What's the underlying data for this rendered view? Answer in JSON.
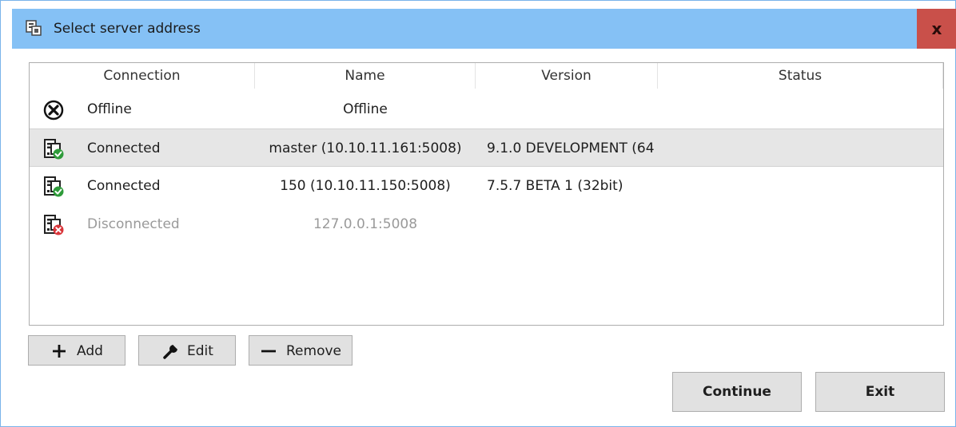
{
  "window": {
    "title": "Select server address",
    "close_label": "x"
  },
  "table": {
    "columns": [
      "Connection",
      "Name",
      "Version",
      "Status"
    ],
    "rows": [
      {
        "icon": "offline-x-icon",
        "connection": "Offline",
        "name": "Offline",
        "version": "",
        "status": "",
        "selected": false,
        "disabled": false
      },
      {
        "icon": "server-connected-icon",
        "connection": "Connected",
        "name": "master (10.10.11.161:5008)",
        "version": "9.1.0 DEVELOPMENT (64",
        "status": "",
        "selected": true,
        "disabled": false
      },
      {
        "icon": "server-connected-icon",
        "connection": "Connected",
        "name": "150 (10.10.11.150:5008)",
        "version": "7.5.7 BETA 1 (32bit)",
        "status": "",
        "selected": false,
        "disabled": false
      },
      {
        "icon": "server-disconnected-icon",
        "connection": "Disconnected",
        "name": "127.0.0.1:5008",
        "version": "",
        "status": "",
        "selected": false,
        "disabled": true
      }
    ]
  },
  "buttons": {
    "add": "Add",
    "edit": "Edit",
    "remove": "Remove",
    "continue": "Continue",
    "exit": "Exit"
  },
  "colors": {
    "titlebar": "#85c1f5",
    "close": "#c9504a",
    "selected_row": "#e6e6e6",
    "connected_badge": "#2e9b3a",
    "disconnected_badge": "#d9353a"
  }
}
